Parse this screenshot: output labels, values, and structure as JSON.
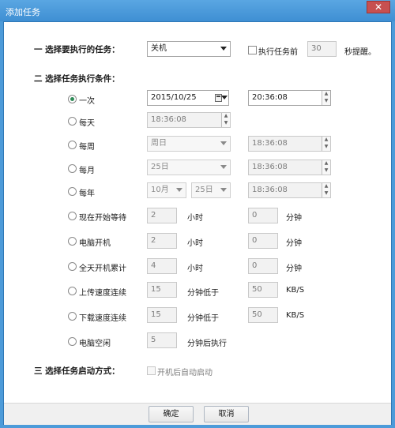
{
  "window": {
    "title": "添加任务",
    "close_glyph": "✕"
  },
  "sections": {
    "task": "一 选择要执行的任务：",
    "condition": "二 选择任务执行条件：",
    "start_mode": "三 选择任务启动方式："
  },
  "task_select": {
    "value": "关机"
  },
  "notify": {
    "label": "执行任务前",
    "value": "30",
    "suffix": "秒提醒。"
  },
  "conditions": {
    "once": {
      "label": "一次",
      "date": "2015/10/25",
      "time": "20:36:08"
    },
    "daily": {
      "label": "每天",
      "time": "18:36:08"
    },
    "weekly": {
      "label": "每周",
      "day": "周日",
      "time": "18:36:08"
    },
    "monthly": {
      "label": "每月",
      "day": "25日",
      "time": "18:36:08"
    },
    "yearly": {
      "label": "每年",
      "month": "10月",
      "day": "25日",
      "time": "18:36:08"
    },
    "wait": {
      "label": "现在开始等待",
      "hours": "2",
      "hours_unit": "小时",
      "minutes": "0",
      "minutes_unit": "分钟"
    },
    "boot": {
      "label": "电脑开机",
      "hours": "2",
      "hours_unit": "小时",
      "minutes": "0",
      "minutes_unit": "分钟"
    },
    "uptime": {
      "label": "全天开机累计",
      "hours": "4",
      "hours_unit": "小时",
      "minutes": "0",
      "minutes_unit": "分钟"
    },
    "upload": {
      "label": "上传速度连续",
      "minutes": "15",
      "minutes_text": "分钟低于",
      "speed": "50",
      "speed_unit": "KB/S"
    },
    "download": {
      "label": "下载速度连续",
      "minutes": "15",
      "minutes_text": "分钟低于",
      "speed": "50",
      "speed_unit": "KB/S"
    },
    "idle": {
      "label": "电脑空闲",
      "minutes": "5",
      "minutes_text": "分钟后执行"
    }
  },
  "start_option": {
    "label": "开机后自动启动"
  },
  "buttons": {
    "ok": "确定",
    "cancel": "取消"
  },
  "colors": {
    "titlebar": "#4d9bd9",
    "close": "#c75050"
  },
  "icons": {
    "close": "close-icon",
    "dropdown": "chevron-down-icon",
    "calendar": "calendar-icon",
    "spin_up": "spin-up-icon",
    "spin_down": "spin-down-icon"
  }
}
